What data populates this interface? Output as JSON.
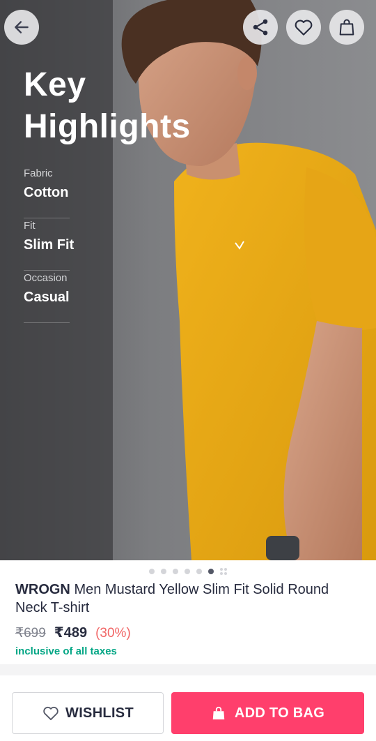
{
  "highlights": {
    "title_line1": "Key",
    "title_line2": "Highlights",
    "items": [
      {
        "label": "Fabric",
        "value": "Cotton"
      },
      {
        "label": "Fit",
        "value": "Slim Fit"
      },
      {
        "label": "Occasion",
        "value": "Casual"
      }
    ]
  },
  "header_icons": [
    "back-arrow-icon",
    "share-icon",
    "heart-icon",
    "shopping-bag-icon"
  ],
  "carousel": {
    "total_dots": 7,
    "active_index": 5
  },
  "product": {
    "brand": "WROGN",
    "name": "Men Mustard Yellow Slim Fit Solid Round Neck T-shirt",
    "mrp": "₹699",
    "price": "₹489",
    "discount": "(30%)",
    "tax_note": "inclusive of all taxes"
  },
  "actions": {
    "wishlist_label": "WISHLIST",
    "add_to_bag_label": "ADD TO BAG"
  },
  "colors": {
    "accent": "#ff3f6c",
    "discount": "#f16565",
    "tax_note": "#03a685",
    "text": "#282c3f"
  }
}
